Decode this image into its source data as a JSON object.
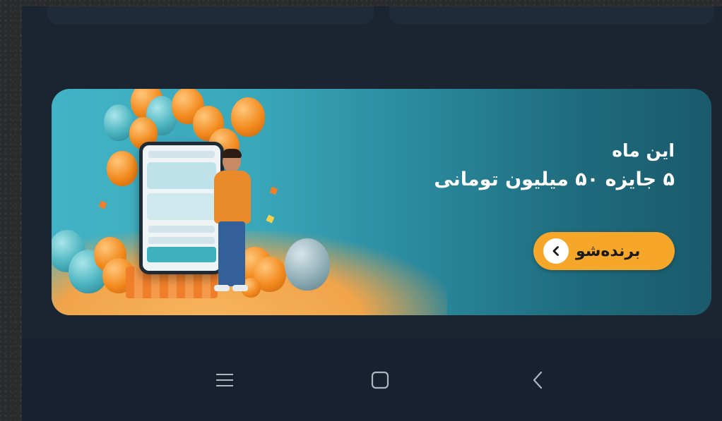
{
  "banner": {
    "headline_line1": "این ماه",
    "headline_line2": "۵ جایزه ۵۰ میلیون تومانی",
    "cta_label": "برنده‌شو",
    "cta_icon": "chevron-left-icon",
    "colors": {
      "gradient_start": "#42b3c6",
      "gradient_end": "#1a5a6b",
      "cta_background": "#f6a72a",
      "headline_text": "#ffffff"
    }
  },
  "navbar": {
    "items": [
      {
        "icon": "recent-apps-icon"
      },
      {
        "icon": "home-icon"
      },
      {
        "icon": "back-icon"
      }
    ]
  }
}
